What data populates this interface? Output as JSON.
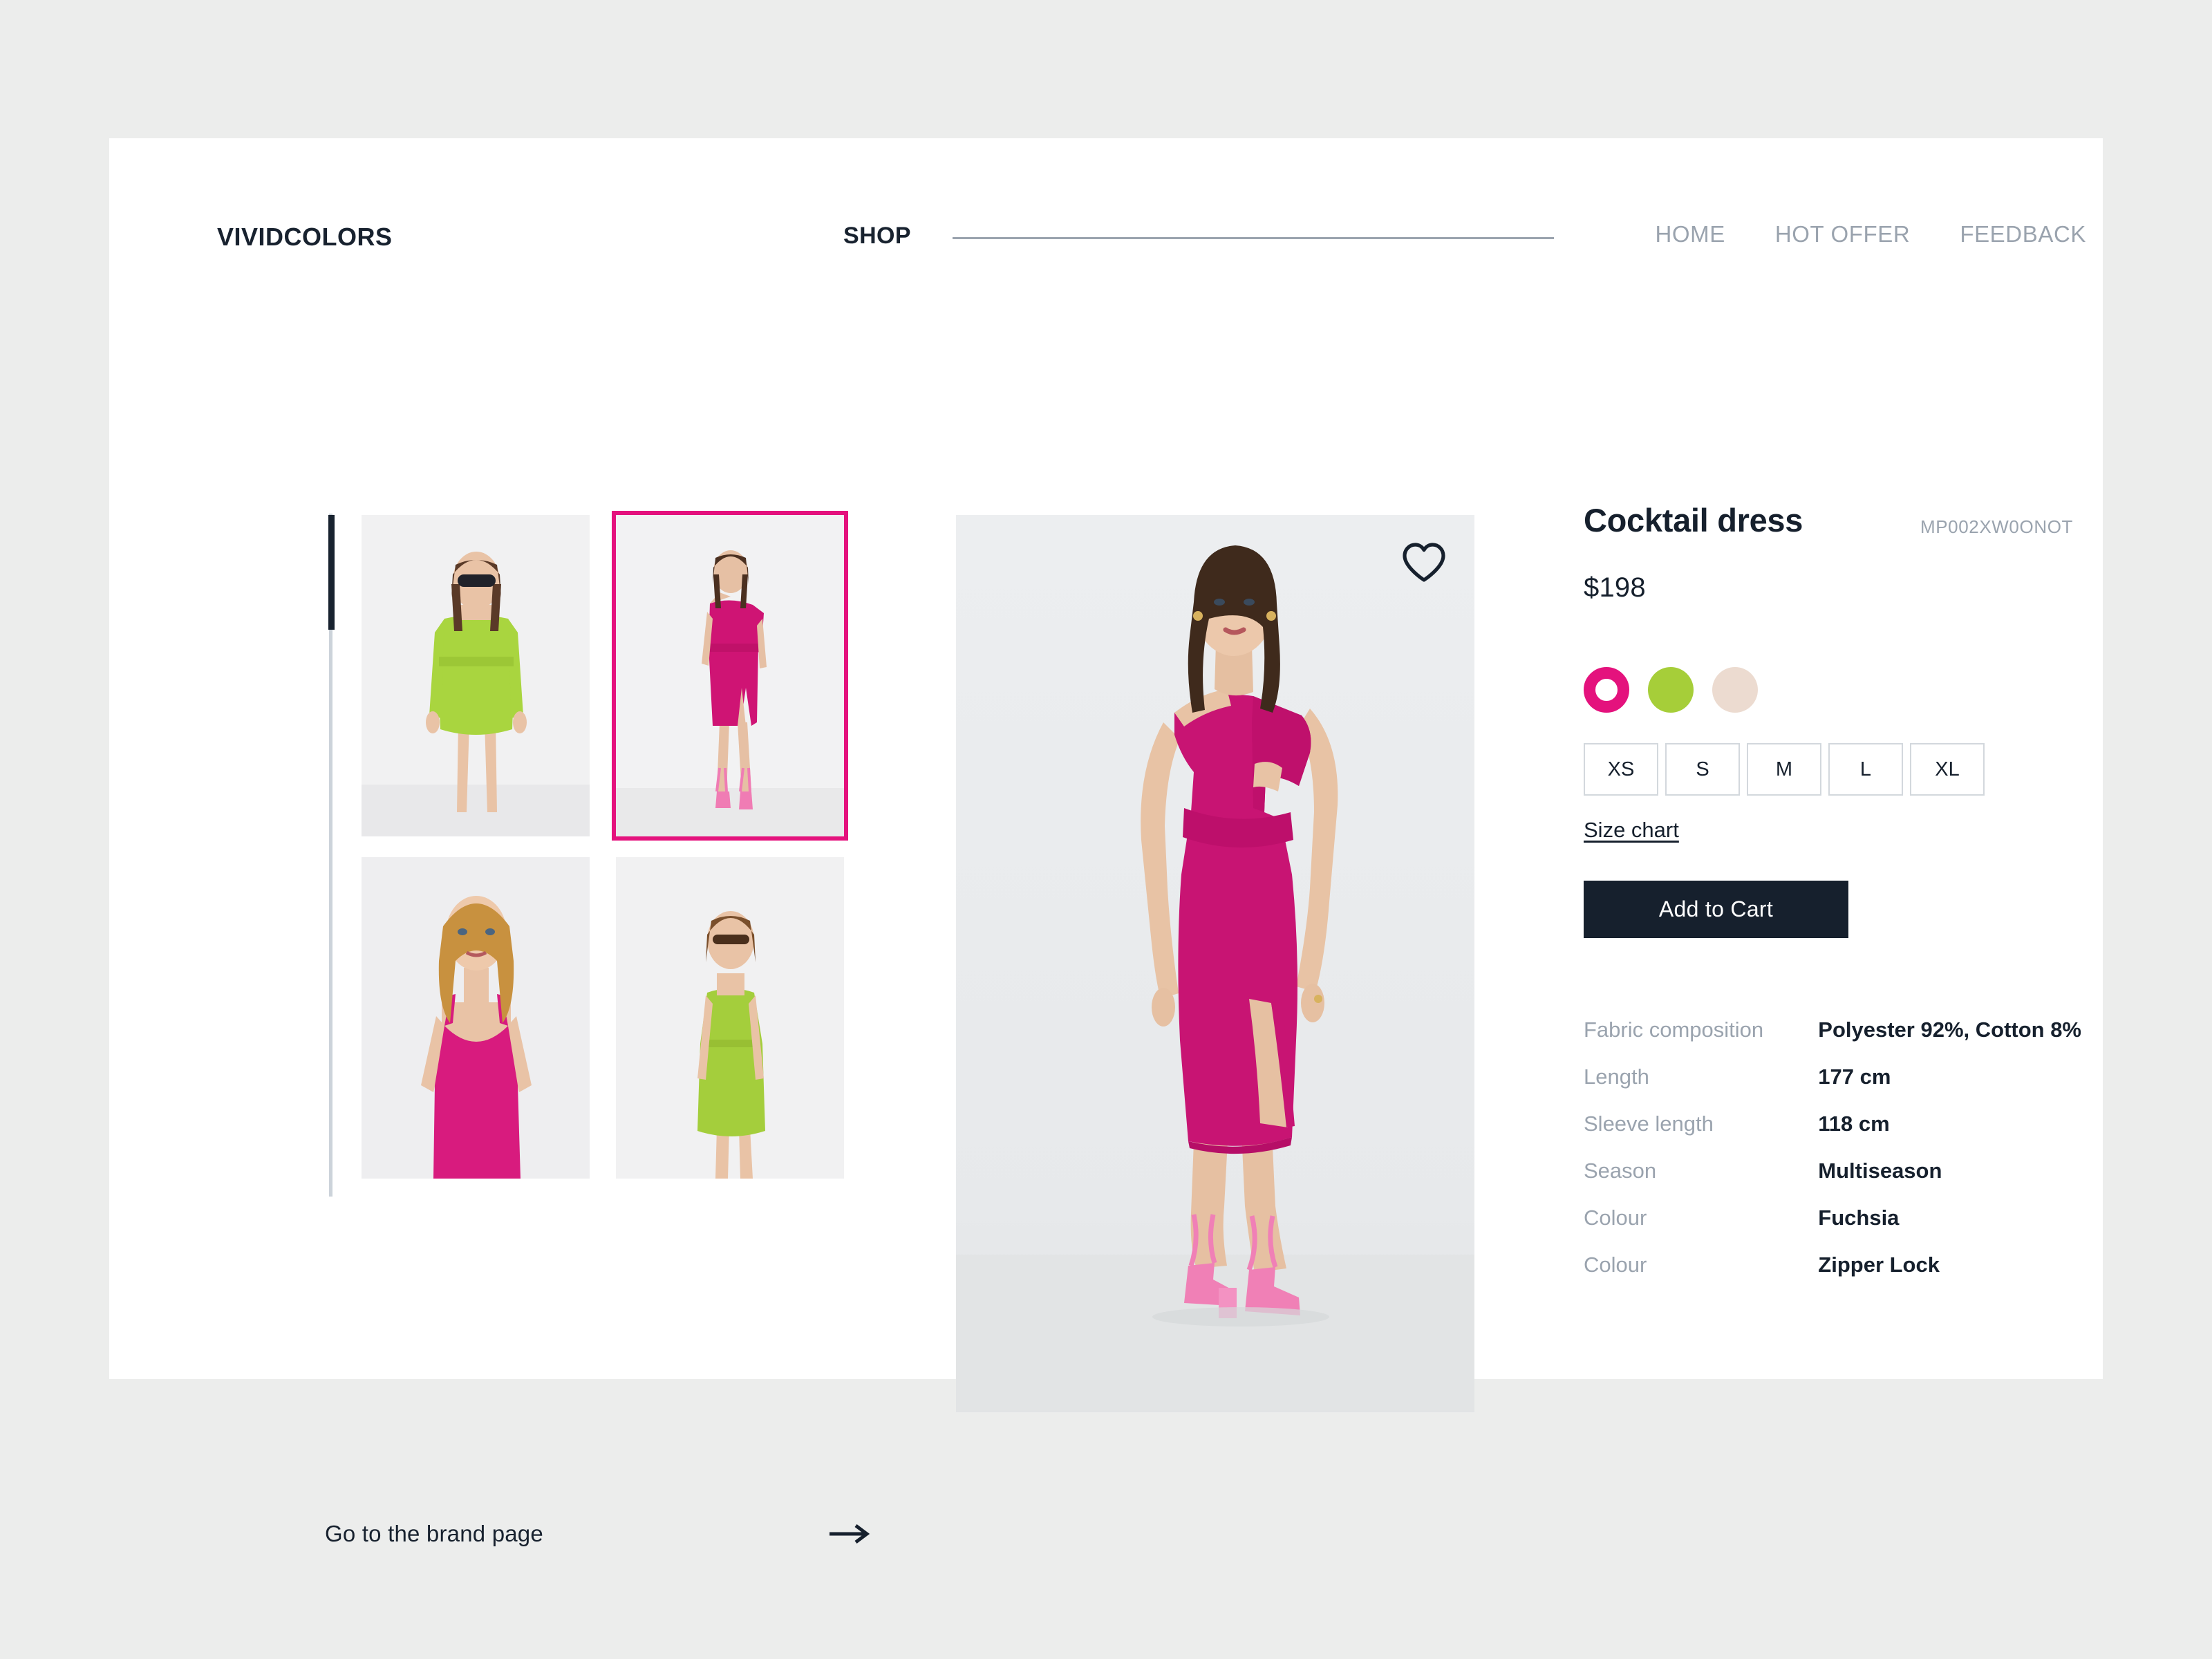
{
  "header": {
    "brand": "VIVIDCOLORS",
    "shop_label": "SHOP",
    "nav": [
      {
        "label": "HOME"
      },
      {
        "label": "HOT OFFER"
      },
      {
        "label": "FEEDBACK"
      }
    ]
  },
  "gallery": {
    "thumbnails": [
      {
        "alt": "Green long sleeve mini dress",
        "selected": false
      },
      {
        "alt": "Fuchsia one shoulder midi dress",
        "selected": true
      },
      {
        "alt": "Fuchsia slip dress",
        "selected": false
      },
      {
        "alt": "Green sleeveless mini dress",
        "selected": false
      }
    ],
    "brand_page_label": "Go to the brand page"
  },
  "hero": {
    "alt": "Model wearing fuchsia one shoulder midi dress with side slit",
    "wishlist_icon": "heart-icon"
  },
  "product": {
    "title": "Cocktail dress",
    "sku": "MP002XW0ONOT",
    "price": "$198",
    "colors": [
      {
        "name": "Fuchsia",
        "hex": "#e4127d",
        "selected": true
      },
      {
        "name": "Lime",
        "hex": "#a6ce39",
        "selected": false
      },
      {
        "name": "Beige",
        "hex": "#ecdbd0",
        "selected": false
      }
    ],
    "sizes": [
      {
        "label": "XS"
      },
      {
        "label": "S"
      },
      {
        "label": "M"
      },
      {
        "label": "L"
      },
      {
        "label": "XL"
      }
    ],
    "size_chart_label": "Size chart",
    "add_to_cart_label": "Add to Cart",
    "specs": [
      {
        "label": "Fabric composition",
        "value": "Polyester 92%, Cotton 8%"
      },
      {
        "label": "Length",
        "value": "177 cm"
      },
      {
        "label": "Sleeve length",
        "value": "118 cm"
      },
      {
        "label": "Season",
        "value": "Multiseason"
      },
      {
        "label": "Colour",
        "value": "Fuchsia"
      },
      {
        "label": "Colour",
        "value": "Zipper Lock"
      }
    ]
  },
  "theme": {
    "accent": "#e4127d",
    "dark": "#16202d",
    "muted": "#9aa3ae",
    "page_bg": "#ecedec",
    "card_bg": "#ffffff"
  }
}
